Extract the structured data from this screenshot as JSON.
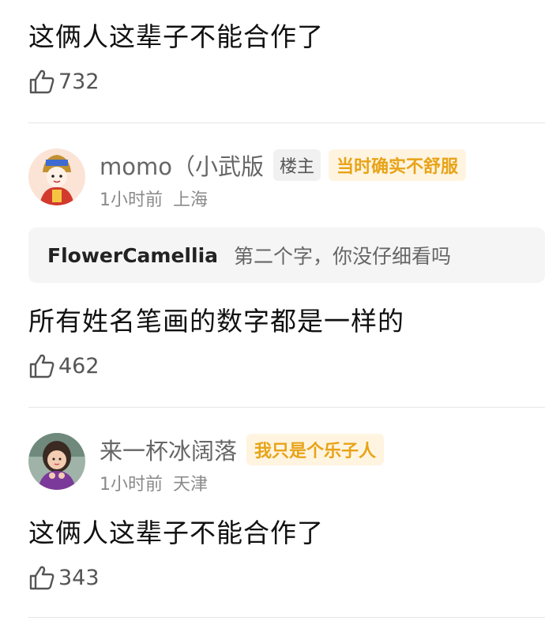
{
  "comments": [
    {
      "content": "这俩人这辈子不能合作了",
      "likes": "732"
    },
    {
      "username": "momo（小武版",
      "host_badge": "楼主",
      "tag": "当时确实不舒服",
      "time": "1小时前",
      "location": "上海",
      "quote": {
        "author": "FlowerCamellia",
        "text": "第二个字，你没仔细看吗"
      },
      "content": "所有姓名笔画的数字都是一样的",
      "likes": "462"
    },
    {
      "username": "来一杯冰阔落",
      "tag": "我只是个乐子人",
      "time": "1小时前",
      "location": "天津",
      "content": "这俩人这辈子不能合作了",
      "likes": "343"
    }
  ],
  "colors": {
    "tag_text": "#e8a317",
    "tag_bg": "#fff4e0",
    "divider": "#e6e6e6"
  },
  "icons": [
    "thumbs-up-icon"
  ]
}
